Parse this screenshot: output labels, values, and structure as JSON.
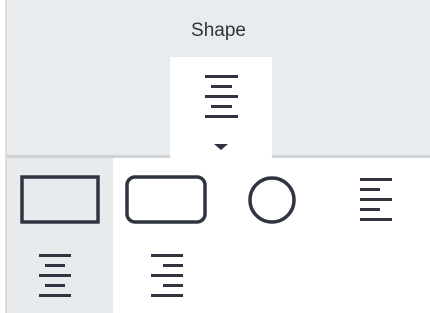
{
  "panel": {
    "title": "Shape"
  },
  "dropdown": {
    "icon": "text-align-center-icon",
    "caret": "caret-down-icon"
  },
  "options": [
    {
      "icon": "rectangle-shape-icon",
      "selected": true
    },
    {
      "icon": "rounded-rectangle-shape-icon",
      "selected": false
    },
    {
      "icon": "circle-shape-icon",
      "selected": false
    },
    {
      "icon": "text-align-left-icon",
      "selected": false
    },
    {
      "icon": "text-align-center-icon",
      "selected": true
    },
    {
      "icon": "text-align-right-icon",
      "selected": false
    }
  ],
  "colors": {
    "header_bg": "#e9ecef",
    "icon": "#2f3440",
    "selected_bg": "#e8ebee"
  }
}
